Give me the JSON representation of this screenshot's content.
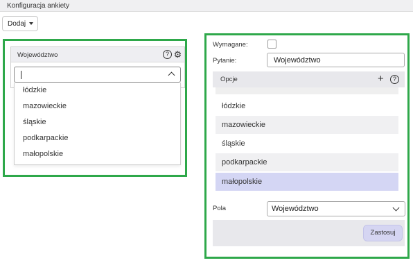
{
  "header": {
    "title": "Konfiguracja ankiety"
  },
  "toolbar": {
    "add_label": "Dodaj"
  },
  "preview": {
    "widget_title": "Województwo",
    "dropdown_value": "",
    "options": [
      "łódzkie",
      "mazowieckie",
      "śląskie",
      "podkarpackie",
      "małopolskie"
    ]
  },
  "config": {
    "required_label": "Wymagane:",
    "required_checked": false,
    "question_label": "Pytanie:",
    "question_value": "Województwo",
    "options_label": "Opcje",
    "options": [
      {
        "label": "łódzkie",
        "selected": false
      },
      {
        "label": "mazowieckie",
        "selected": false
      },
      {
        "label": "śląskie",
        "selected": false
      },
      {
        "label": "podkarpackie",
        "selected": false
      },
      {
        "label": "małopolskie",
        "selected": true
      }
    ],
    "field_label": "Pola",
    "field_value": "Województwo",
    "apply_label": "Zastosuj"
  },
  "colors": {
    "frame_green": "#2ea84a",
    "row_alt": "#f0f0f2",
    "row_selected": "#d4d6f4",
    "apply_button": "#d5d5f2"
  }
}
